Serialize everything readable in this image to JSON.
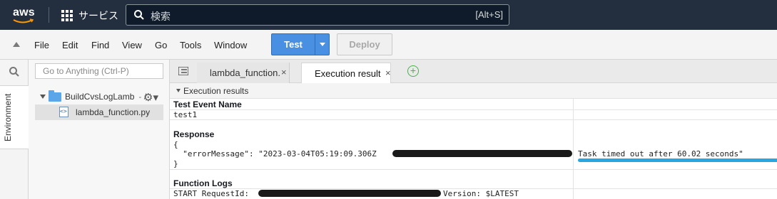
{
  "topbar": {
    "logo_text": "aws",
    "services_label": "サービス",
    "search_placeholder": "検索",
    "search_shortcut": "[Alt+S]"
  },
  "ide_toolbar": {
    "menus": [
      "File",
      "Edit",
      "Find",
      "View",
      "Go",
      "Tools",
      "Window"
    ],
    "test_label": "Test",
    "deploy_label": "Deploy"
  },
  "sidebar": {
    "goto_placeholder": "Go to Anything (Ctrl-P)",
    "environment_label": "Environment",
    "folder_label": "BuildCvsLogLamb",
    "folder_suffix": "- /",
    "file_label": "lambda_function.py"
  },
  "tabs": [
    {
      "label": "lambda_function."
    },
    {
      "label": "Execution result"
    }
  ],
  "execution": {
    "header": "Execution results",
    "test_event_title": "Test Event Name",
    "test_event_value": "test1",
    "response_title": "Response",
    "response_open": "{",
    "response_line_prefix": "  \"errorMessage\": \"2023-03-04T05:19:09.306Z",
    "response_line_suffix": "Task timed out after 60.02 seconds\"",
    "response_close": "}",
    "logs_title": "Function Logs",
    "logs_line_prefix": "START RequestId:",
    "logs_line_suffix": "Version: $LATEST"
  },
  "colors": {
    "topbar_bg": "#232f3e",
    "test_button": "#4a90e2",
    "highlight_underline": "#29a6e0"
  }
}
